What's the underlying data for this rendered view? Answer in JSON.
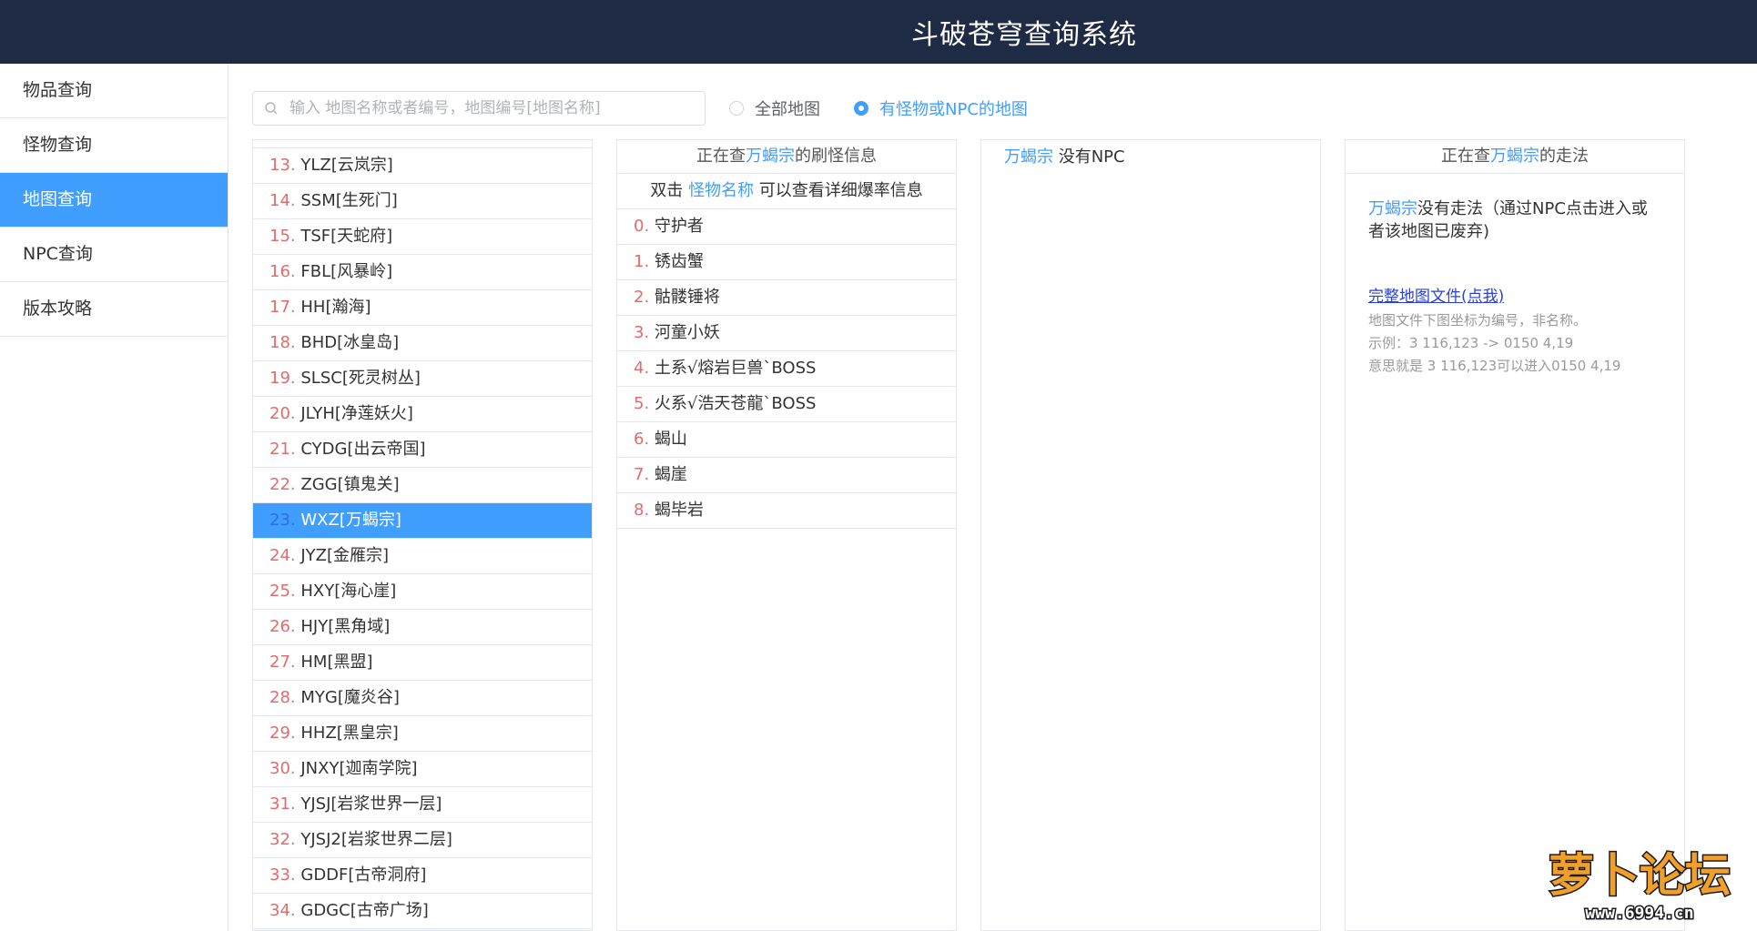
{
  "header": {
    "title": "斗破苍穹查询系统"
  },
  "sidebar": {
    "items": [
      {
        "label": "物品查询"
      },
      {
        "label": "怪物查询"
      },
      {
        "label": "地图查询"
      },
      {
        "label": "NPC查询"
      },
      {
        "label": "版本攻略"
      }
    ]
  },
  "search": {
    "placeholder": "输入 地图名称或者编号，地图编号[地图名称]",
    "value": ""
  },
  "filters": {
    "all_maps": "全部地图",
    "with_monsters": "有怪物或NPC的地图"
  },
  "map_list": [
    {
      "num": "13.",
      "name": "YLZ[云岚宗]"
    },
    {
      "num": "14.",
      "name": "SSM[生死门]"
    },
    {
      "num": "15.",
      "name": "TSF[天蛇府]"
    },
    {
      "num": "16.",
      "name": "FBL[风暴岭]"
    },
    {
      "num": "17.",
      "name": "HH[瀚海]"
    },
    {
      "num": "18.",
      "name": "BHD[冰皇岛]"
    },
    {
      "num": "19.",
      "name": "SLSC[死灵树丛]"
    },
    {
      "num": "20.",
      "name": "JLYH[净莲妖火]"
    },
    {
      "num": "21.",
      "name": "CYDG[出云帝国]"
    },
    {
      "num": "22.",
      "name": "ZGG[镇鬼关]"
    },
    {
      "num": "23.",
      "name": "WXZ[万蝎宗]"
    },
    {
      "num": "24.",
      "name": "JYZ[金雁宗]"
    },
    {
      "num": "25.",
      "name": "HXY[海心崖]"
    },
    {
      "num": "26.",
      "name": "HJY[黑角域]"
    },
    {
      "num": "27.",
      "name": "HM[黑盟]"
    },
    {
      "num": "28.",
      "name": "MYG[魔炎谷]"
    },
    {
      "num": "29.",
      "name": "HHZ[黑皇宗]"
    },
    {
      "num": "30.",
      "name": "JNXY[迦南学院]"
    },
    {
      "num": "31.",
      "name": "YJSJ[岩浆世界一层]"
    },
    {
      "num": "32.",
      "name": "YJSJ2[岩浆世界二层]"
    },
    {
      "num": "33.",
      "name": "GDDF[古帝洞府]"
    },
    {
      "num": "34.",
      "name": "GDGC[古帝广场]"
    }
  ],
  "monster_panel": {
    "head_prefix": "正在查",
    "map_name": "万蝎宗",
    "head_suffix": "的刷怪信息",
    "sub_prefix": "双击 ",
    "sub_link": "怪物名称",
    "sub_suffix": " 可以查看详细爆率信息",
    "monsters": [
      {
        "num": "0.",
        "name": "守护者"
      },
      {
        "num": "1.",
        "name": "锈齿蟹"
      },
      {
        "num": "2.",
        "name": "骷髅锤将"
      },
      {
        "num": "3.",
        "name": "河童小妖"
      },
      {
        "num": "4.",
        "name": "土系√熔岩巨兽`BOSS"
      },
      {
        "num": "5.",
        "name": "火系√浩天苍龍`BOSS"
      },
      {
        "num": "6.",
        "name": "蝎山"
      },
      {
        "num": "7.",
        "name": "蝎崖"
      },
      {
        "num": "8.",
        "name": "蝎毕岩"
      }
    ]
  },
  "npc_panel": {
    "map_name": "万蝎宗",
    "text": " 没有NPC"
  },
  "route_panel": {
    "head_prefix": "正在查",
    "map_name": "万蝎宗",
    "head_suffix": "的走法",
    "desc": "没有走法（通过NPC点击进入或者该地图已废弃)",
    "link": "完整地图文件(点我)",
    "note1": "地图文件下图坐标为编号，非名称。",
    "note2": "示例：3 116,123 -> 0150 4,19",
    "note3": "意思就是 3 116,123可以进入0150 4,19"
  },
  "watermark": {
    "text": "萝卜论坛",
    "url": "www.6994.cn"
  },
  "colors": {
    "accent": "#409eff",
    "header_bg": "#1f2a44",
    "number": "#e06c6c"
  }
}
